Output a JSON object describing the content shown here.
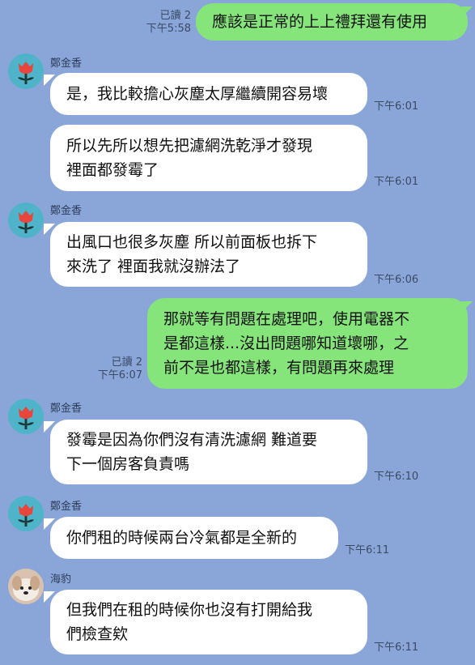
{
  "messages": [
    {
      "id": "m1",
      "side": "out",
      "text": "應該是正常的上上禮拜還有使用",
      "read": "已讀 2",
      "time": "下午5:58"
    },
    {
      "id": "m2",
      "side": "in",
      "sender": "鄭金香",
      "text": "是，我比較擔心灰塵太厚繼續開容易壞",
      "time": "下午6:01"
    },
    {
      "id": "m3",
      "side": "in",
      "text": "所以先所以想先把濾網洗乾淨才發現\n裡面都發霉了",
      "time": "下午6:01"
    },
    {
      "id": "m4",
      "side": "in",
      "sender": "鄭金香",
      "text": "出風口也很多灰塵 所以前面板也拆下\n來洗了 裡面我就沒辦法了",
      "time": "下午6:06"
    },
    {
      "id": "m5",
      "side": "out",
      "text": "那就等有問題在處理吧，使用電器不\n是都這樣...沒出問題哪知道壞哪，之\n前不是也都這樣，有問題再來處理",
      "read": "已讀 2",
      "time": "下午6:07"
    },
    {
      "id": "m6",
      "side": "in",
      "sender": "鄭金香",
      "text": "發霉是因為你們沒有清洗濾網 難道要\n下一個房客負責嗎",
      "time": "下午6:10"
    },
    {
      "id": "m7",
      "side": "in",
      "sender": "鄭金香",
      "text": "你們租的時候兩台冷氣都是全新的",
      "time": "下午6:11"
    },
    {
      "id": "m8",
      "side": "in",
      "sender": "海豹",
      "text": "但我們在租的時候你也沒有打開給我\n們檢查欸",
      "time": "下午6:11"
    }
  ],
  "avatars": {
    "flower": "flower-avatar",
    "dog": "dog-avatar"
  },
  "colors": {
    "background": "#8aa6d8",
    "incoming": "#ffffff",
    "outgoing": "#86e57a"
  }
}
